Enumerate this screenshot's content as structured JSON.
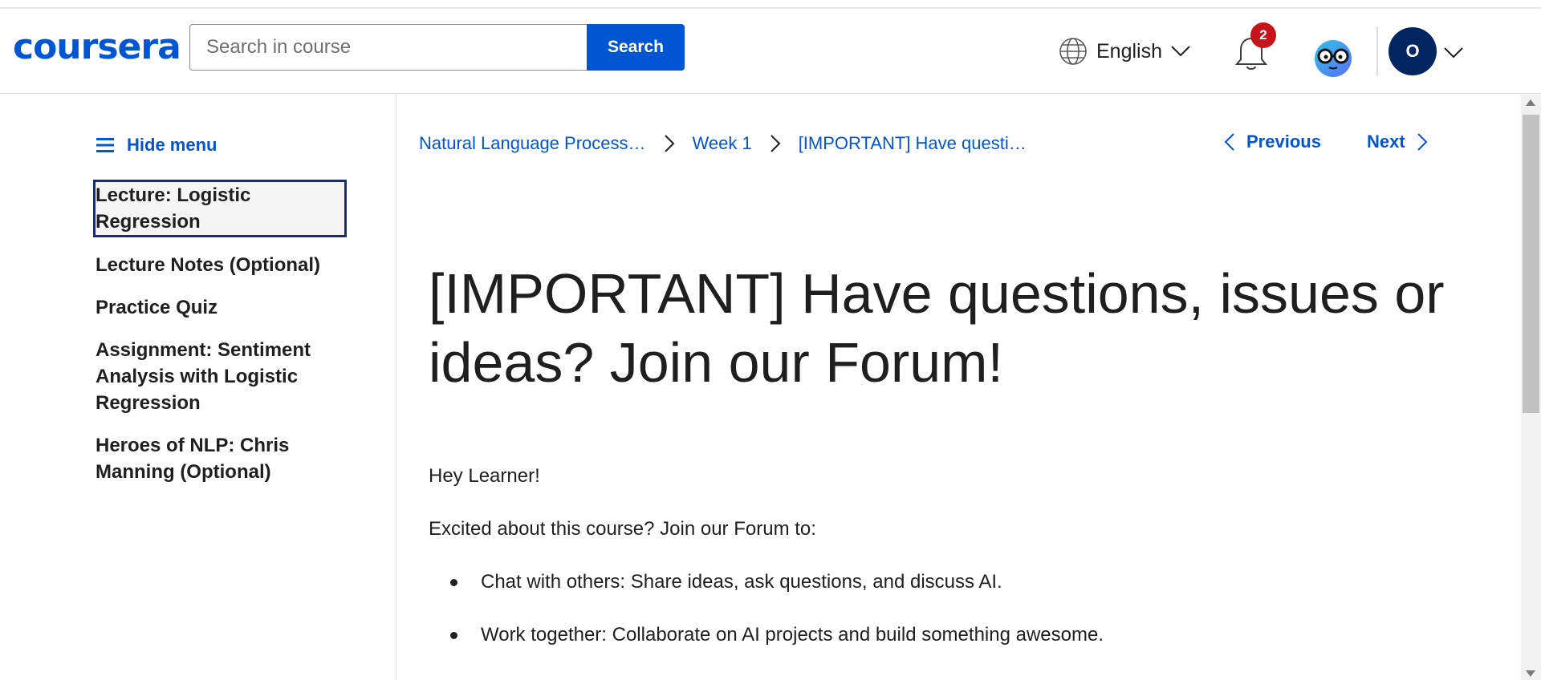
{
  "header": {
    "logo": "coursera",
    "search": {
      "placeholder": "Search in course",
      "value": "",
      "button_label": "Search"
    },
    "language": {
      "label": "English",
      "icon": "globe-icon"
    },
    "notifications": {
      "count": "2",
      "icon": "bell-icon"
    },
    "coach_icon": "coach-glasses-icon",
    "user": {
      "initial": "O"
    }
  },
  "sidebar": {
    "hide_menu_label": "Hide menu",
    "items": [
      {
        "label": "Lecture: Logistic Regression",
        "active": true
      },
      {
        "label": "Lecture Notes (Optional)"
      },
      {
        "label": "Practice Quiz"
      },
      {
        "label": "Assignment: Sentiment Analysis with Logistic Regression"
      },
      {
        "label": "Heroes of NLP: Chris Manning (Optional)"
      }
    ]
  },
  "breadcrumb": [
    {
      "label": "Natural Language Process…"
    },
    {
      "label": "Week 1"
    },
    {
      "label": "[IMPORTANT] Have questi…"
    }
  ],
  "pager": {
    "previous_label": "Previous",
    "next_label": "Next"
  },
  "main": {
    "title": "[IMPORTANT] Have questions, issues or ideas? Join our Forum!",
    "greeting": "Hey Learner!",
    "intro": "Excited about this course? Join our Forum to:",
    "bullets": [
      "Chat with others: Share ideas, ask questions, and discuss AI.",
      "Work together: Collaborate on AI projects and build something awesome."
    ]
  },
  "colors": {
    "brand": "#0056d2",
    "badge": "#c4151c",
    "avatar": "#002561"
  }
}
